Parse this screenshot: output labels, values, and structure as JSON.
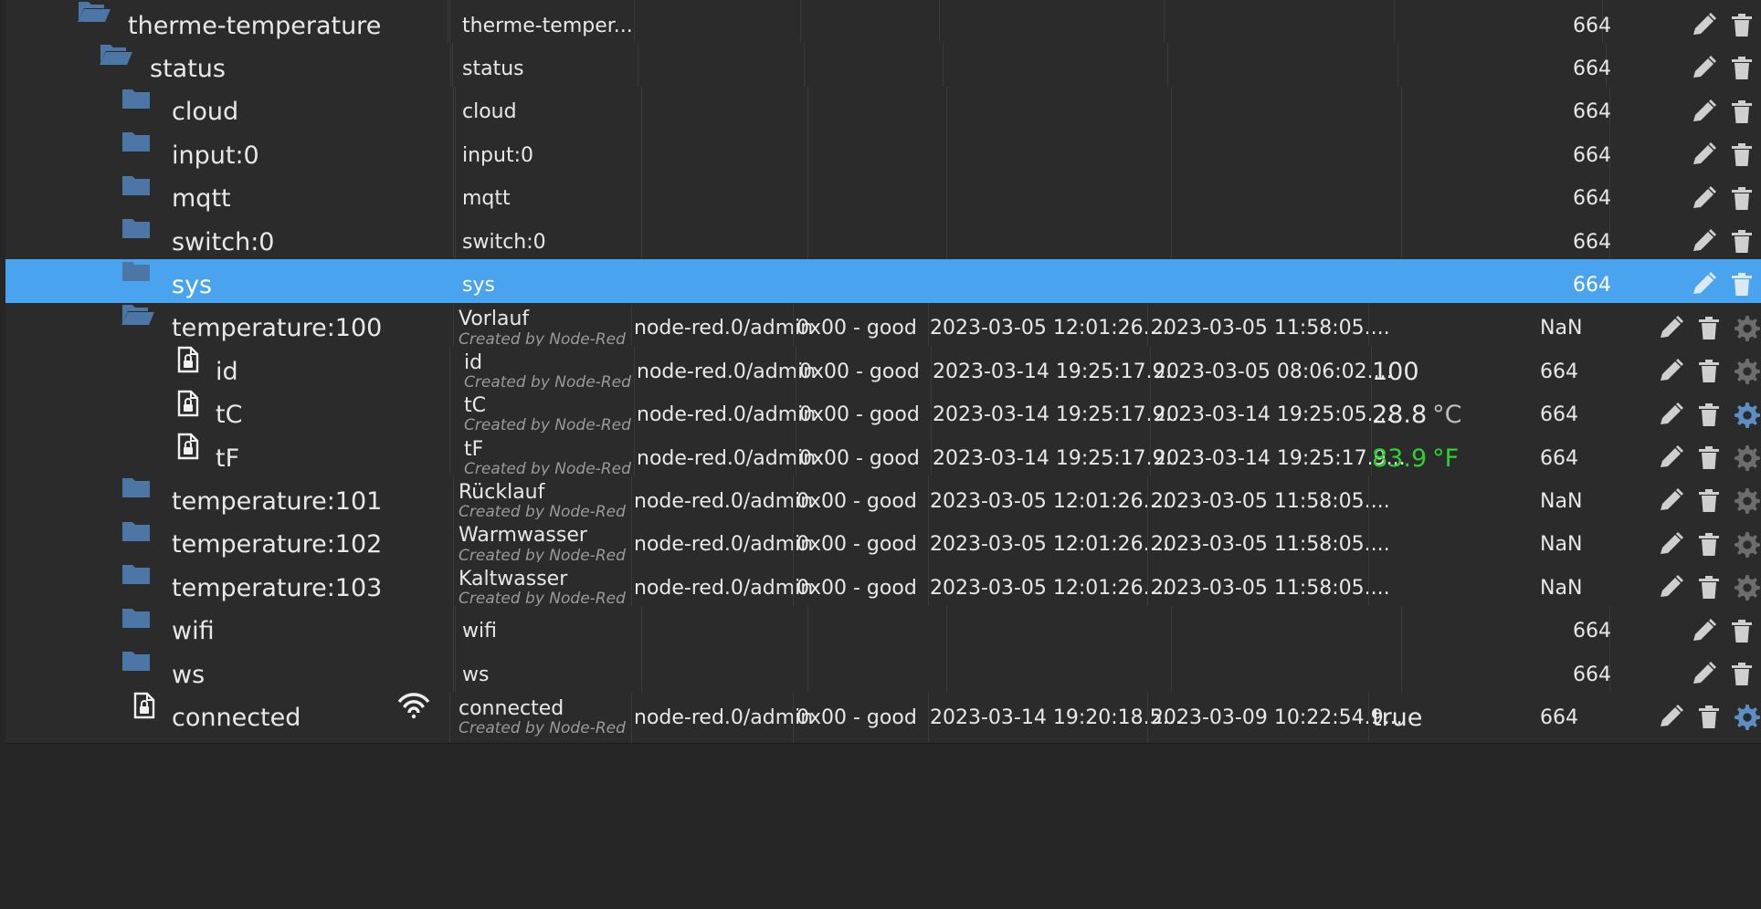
{
  "colors": {
    "background": "#2b2b2b",
    "selected": "#4aa3ef",
    "folder": "#4b76a6",
    "value_green": "#2fd12f"
  },
  "rows": [
    {
      "indent": 0,
      "kind": "folder-open",
      "label": "therme-temperature",
      "name": "therme-temper...",
      "acl": "664"
    },
    {
      "indent": 1,
      "kind": "folder-open",
      "label": "status",
      "name": "status",
      "acl": "664"
    },
    {
      "indent": 2,
      "kind": "folder",
      "label": "cloud",
      "name": "cloud",
      "acl": "664"
    },
    {
      "indent": 2,
      "kind": "folder",
      "label": "input:0",
      "name": "input:0",
      "acl": "664"
    },
    {
      "indent": 2,
      "kind": "folder",
      "label": "mqtt",
      "name": "mqtt",
      "acl": "664"
    },
    {
      "indent": 2,
      "kind": "folder",
      "label": "switch:0",
      "name": "switch:0",
      "acl": "664"
    },
    {
      "indent": 2,
      "kind": "folder",
      "label": "sys",
      "name": "sys",
      "acl": "664",
      "selected": true
    },
    {
      "indent": 2,
      "kind": "folder-open",
      "label": "temperature:100",
      "name": "Vorlauf",
      "sub": "Created by Node-Red",
      "user": "node-red.0/admin",
      "quality": "0x00 - good",
      "ts1": "2023-03-05 12:01:26....",
      "ts2": "2023-03-05 11:58:05....",
      "acl": "NaN"
    },
    {
      "indent": 3,
      "kind": "state",
      "label": "id",
      "name": "id",
      "sub": "Created by Node-Red",
      "user": "node-red.0/admin",
      "quality": "0x00 - good",
      "ts1": "2023-03-14 19:25:17.9...",
      "ts2": "2023-03-05 08:06:02....",
      "value": "100",
      "acl": "664",
      "gear": true
    },
    {
      "indent": 3,
      "kind": "state",
      "label": "tC",
      "name": "tC",
      "sub": "Created by Node-Red",
      "user": "node-red.0/admin",
      "quality": "0x00 - good",
      "ts1": "2023-03-14 19:25:17.9...",
      "ts2": "2023-03-14 19:25:05....",
      "value": "28.8",
      "unit": "°C",
      "acl": "664",
      "gear": true,
      "gear_active": true
    },
    {
      "indent": 3,
      "kind": "state",
      "label": "tF",
      "name": "tF",
      "sub": "Created by Node-Red",
      "user": "node-red.0/admin",
      "quality": "0x00 - good",
      "ts1": "2023-03-14 19:25:17.9...",
      "ts2": "2023-03-14 19:25:17.9...",
      "value": "83.9",
      "unit": "°F",
      "value_green": true,
      "acl": "664",
      "gear": true
    },
    {
      "indent": 2,
      "kind": "folder",
      "label": "temperature:101",
      "name": "Rücklauf",
      "sub": "Created by Node-Red",
      "user": "node-red.0/admin",
      "quality": "0x00 - good",
      "ts1": "2023-03-05 12:01:26....",
      "ts2": "2023-03-05 11:58:05....",
      "acl": "NaN"
    },
    {
      "indent": 2,
      "kind": "folder",
      "label": "temperature:102",
      "name": "Warmwasser",
      "sub": "Created by Node-Red",
      "user": "node-red.0/admin",
      "quality": "0x00 - good",
      "ts1": "2023-03-05 12:01:26....",
      "ts2": "2023-03-05 11:58:05....",
      "acl": "NaN"
    },
    {
      "indent": 2,
      "kind": "folder",
      "label": "temperature:103",
      "name": "Kaltwasser",
      "sub": "Created by Node-Red",
      "user": "node-red.0/admin",
      "quality": "0x00 - good",
      "ts1": "2023-03-05 12:01:26....",
      "ts2": "2023-03-05 11:58:05....",
      "acl": "NaN"
    },
    {
      "indent": 2,
      "kind": "folder",
      "label": "wifi",
      "name": "wifi",
      "acl": "664"
    },
    {
      "indent": 2,
      "kind": "folder",
      "label": "ws",
      "name": "ws",
      "acl": "664"
    },
    {
      "indent": 1,
      "kind": "state",
      "label": "connected",
      "wifi": true,
      "name": "connected",
      "sub": "Created by Node-Red",
      "user": "node-red.0/admin",
      "quality": "0x00 - good",
      "ts1": "2023-03-14 19:20:18.5...",
      "ts2": "2023-03-09 10:22:54.9...",
      "value": "true",
      "acl": "664",
      "gear": true,
      "gear_active": true
    }
  ]
}
